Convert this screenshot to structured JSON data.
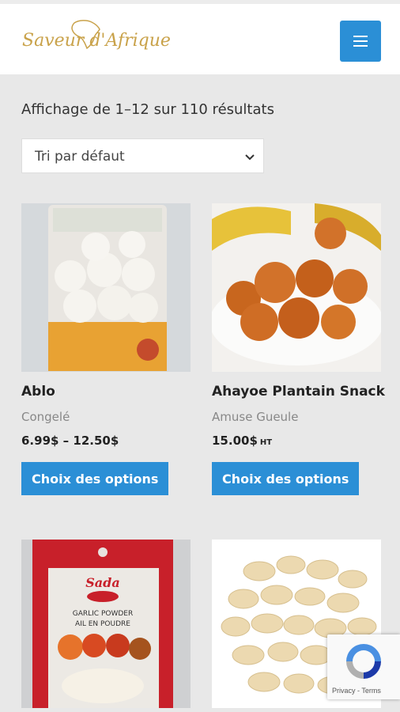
{
  "brand": {
    "logo_text": "Saveur d'Afrique"
  },
  "header": {
    "menu_icon": "hamburger-icon",
    "accent": "#2b8fd6"
  },
  "shop": {
    "result_count": "Affichage de 1–12 sur 110 résultats",
    "sort_selected": "Tri par défaut"
  },
  "products": [
    {
      "title": "Ablo",
      "category": "Congelé",
      "price": "6.99$ – 12.50$",
      "price_suffix": "",
      "button": "Choix des options"
    },
    {
      "title": "Ahayoe Plantain Snack",
      "category": "Amuse Gueule",
      "price": "15.00$",
      "price_suffix": "HT",
      "button": "Choix des options"
    },
    {
      "title": "",
      "category": "",
      "price": "",
      "price_suffix": "",
      "button": "",
      "pack_brand": "Sada",
      "pack_line1": "GARLIC POWDER",
      "pack_line2": "AIL EN POUDRE"
    },
    {
      "title": "",
      "category": "",
      "price": "",
      "price_suffix": "",
      "button": ""
    }
  ],
  "recaptcha": {
    "privacy": "Privacy",
    "separator": " - ",
    "terms": "Terms"
  }
}
